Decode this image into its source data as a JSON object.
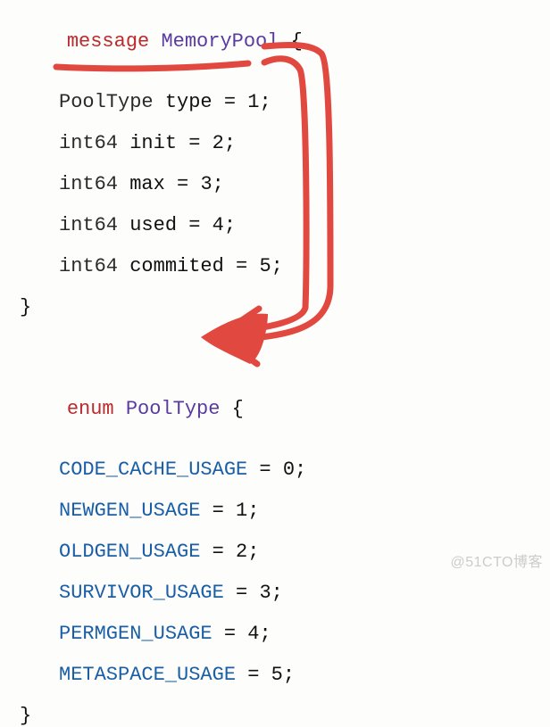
{
  "msg": {
    "keyword": "message",
    "name": "MemoryPool",
    "brace_open": "{",
    "brace_close": "}",
    "fields": [
      {
        "type": "PoolType",
        "name": "type",
        "eq": " = ",
        "num": "1",
        "semi": ";"
      },
      {
        "type": "int64",
        "name": "init",
        "eq": " = ",
        "num": "2",
        "semi": ";"
      },
      {
        "type": "int64",
        "name": "max",
        "eq": " = ",
        "num": "3",
        "semi": ";"
      },
      {
        "type": "int64",
        "name": "used",
        "eq": " = ",
        "num": "4",
        "semi": ";"
      },
      {
        "type": "int64",
        "name": "commited",
        "eq": " = ",
        "num": "5",
        "semi": ";"
      }
    ]
  },
  "enm": {
    "keyword": "enum",
    "name": "PoolType",
    "brace_open": "{",
    "brace_close": "}",
    "values": [
      {
        "name": "CODE_CACHE_USAGE",
        "eq": " = ",
        "num": "0",
        "semi": ";"
      },
      {
        "name": "NEWGEN_USAGE",
        "eq": " = ",
        "num": "1",
        "semi": ";"
      },
      {
        "name": "OLDGEN_USAGE",
        "eq": " = ",
        "num": "2",
        "semi": ";"
      },
      {
        "name": "SURVIVOR_USAGE",
        "eq": " = ",
        "num": "3",
        "semi": ";"
      },
      {
        "name": "PERMGEN_USAGE",
        "eq": " = ",
        "num": "4",
        "semi": ";"
      },
      {
        "name": "METASPACE_USAGE",
        "eq": " = ",
        "num": "5",
        "semi": ";"
      }
    ]
  },
  "watermark": "@51CTO博客",
  "annotation_color": "#e04840"
}
